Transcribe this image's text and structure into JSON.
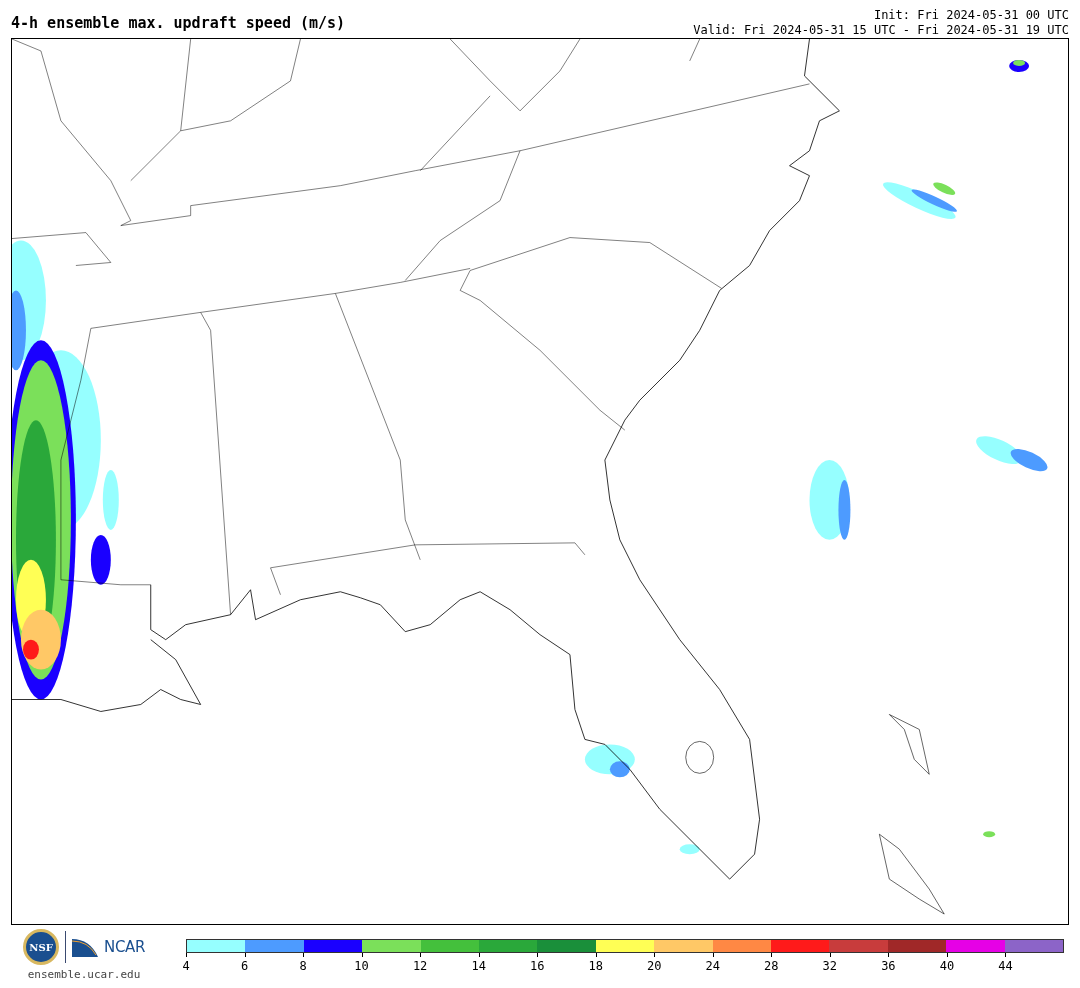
{
  "title": "4-h ensemble max. updraft speed (m/s)",
  "init": "Init: Fri 2024-05-31 00 UTC",
  "valid": "Valid: Fri 2024-05-31 15 UTC - Fri 2024-05-31 19 UTC",
  "footer": {
    "nsf_logo_text": "NSF",
    "ncar_logo_text": "NCAR",
    "site": "ensemble.ucar.edu"
  },
  "colorbar": {
    "bins": [
      {
        "color": "#96ffff"
      },
      {
        "color": "#4d9bff"
      },
      {
        "color": "#1a00ff"
      },
      {
        "color": "#7be05a"
      },
      {
        "color": "#44c03c"
      },
      {
        "color": "#2aa83a"
      },
      {
        "color": "#1a8f3a"
      },
      {
        "color": "#ffff55"
      },
      {
        "color": "#ffc866"
      },
      {
        "color": "#ff8844"
      },
      {
        "color": "#ff1a1a"
      },
      {
        "color": "#c83c3c"
      },
      {
        "color": "#a02828"
      },
      {
        "color": "#e600e6"
      },
      {
        "color": "#8c64c8"
      }
    ],
    "ticks": [
      "4",
      "6",
      "8",
      "10",
      "12",
      "14",
      "16",
      "18",
      "20",
      "24",
      "28",
      "32",
      "36",
      "40",
      "44"
    ]
  }
}
